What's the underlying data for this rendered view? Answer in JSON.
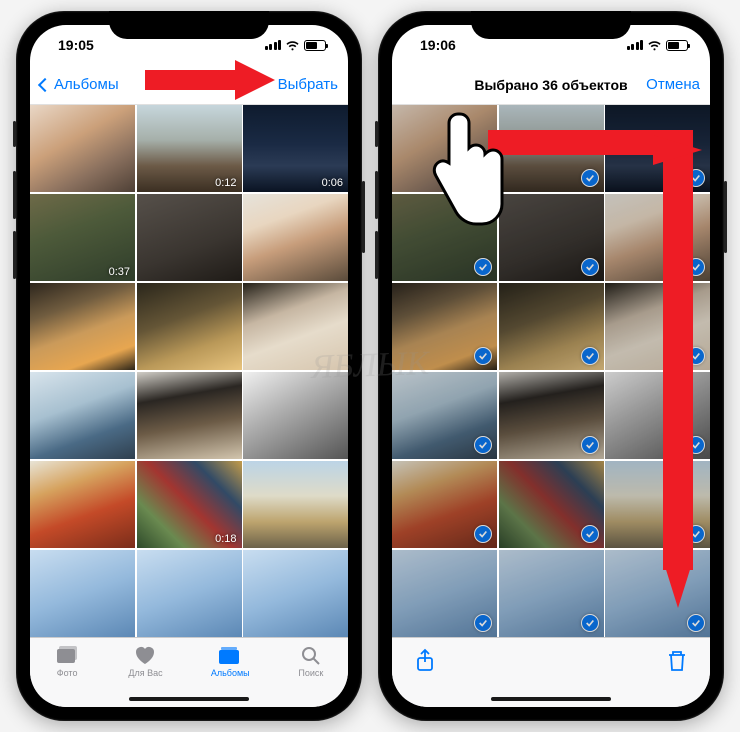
{
  "left": {
    "time": "19:05",
    "back_label": "Альбомы",
    "select_label": "Выбрать",
    "tabs": [
      {
        "label": "Фото"
      },
      {
        "label": "Для Вас"
      },
      {
        "label": "Альбомы"
      },
      {
        "label": "Поиск"
      }
    ],
    "videos": {
      "v1": "0:12",
      "v2": "0:06",
      "v3": "0:37",
      "v4": "0:18"
    }
  },
  "right": {
    "time": "19:06",
    "title": "Выбрано 36 объектов",
    "cancel_label": "Отмена"
  },
  "watermark": "ЯБЛЫК"
}
